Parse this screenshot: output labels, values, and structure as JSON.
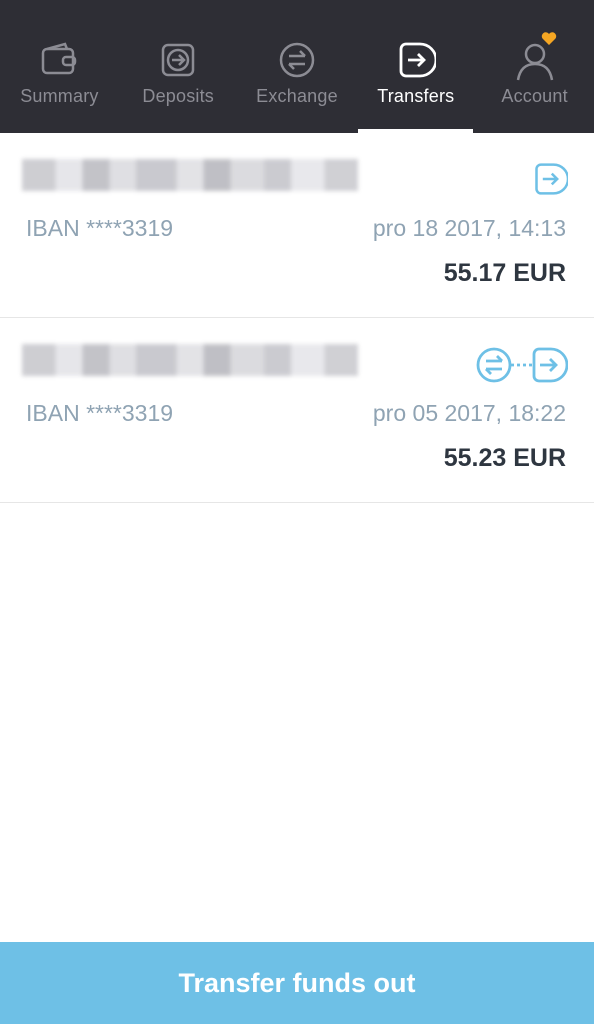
{
  "nav": {
    "tabs": [
      {
        "label": "Summary",
        "icon": "wallet-icon",
        "active": false
      },
      {
        "label": "Deposits",
        "icon": "deposit-icon",
        "active": false
      },
      {
        "label": "Exchange",
        "icon": "exchange-icon",
        "active": false
      },
      {
        "label": "Transfers",
        "icon": "transfer-icon",
        "active": true
      },
      {
        "label": "Account",
        "icon": "account-icon",
        "active": false
      }
    ],
    "account_badge_color": "#f5a623"
  },
  "transfers": [
    {
      "iban": "IBAN ****3319",
      "date": "pro 18 2017, 14:13",
      "amount": "55.17 EUR",
      "icon": "transfer-out-icon"
    },
    {
      "iban": "IBAN ****3319",
      "date": "pro 05 2017, 18:22",
      "amount": "55.23 EUR",
      "icon": "exchange-transfer-icon"
    }
  ],
  "action": {
    "label": "Transfer funds out"
  },
  "colors": {
    "header_bg": "#2e2e35",
    "accent": "#6ec0e6",
    "muted_text": "#8fa3b3"
  }
}
